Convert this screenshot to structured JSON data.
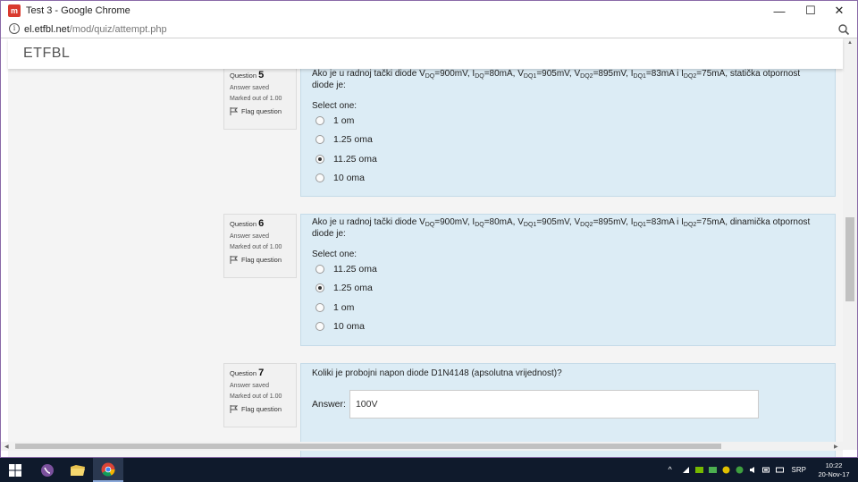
{
  "window": {
    "title": "Test 3 - Google Chrome",
    "app_icon_letter": "m",
    "minimize": "—",
    "maximize": "☐",
    "close": "✕"
  },
  "address_bar": {
    "host": "el.etfbl.net",
    "path": "/mod/quiz/attempt.php"
  },
  "site": {
    "brand": "ETFBL"
  },
  "questions": [
    {
      "label": "Question",
      "number": "5",
      "status": "Answer saved",
      "marked": "Marked out of 1.00",
      "flag": "Flag question",
      "text_parts": [
        "Ako je u radnoj tački diode V",
        "DQ",
        "=900mV, I",
        "DQ",
        "=80mA, V",
        "DQ1",
        "=905mV, V",
        "DQ2",
        "=895mV, I",
        "DQ1",
        "=83mA i I",
        "DQ2",
        "=75mA, statička otpornost diode je:"
      ],
      "select_one": "Select one:",
      "options": [
        "1 om",
        "1.25 oma",
        "11.25 oma",
        "10 oma"
      ],
      "selected_index": 2
    },
    {
      "label": "Question",
      "number": "6",
      "status": "Answer saved",
      "marked": "Marked out of 1.00",
      "flag": "Flag question",
      "text_parts": [
        "Ako je u radnoj tački diode V",
        "DQ",
        "=900mV, I",
        "DQ",
        "=80mA, V",
        "DQ1",
        "=905mV, V",
        "DQ2",
        "=895mV, I",
        "DQ1",
        "=83mA i I",
        "DQ2",
        "=75mA, dinamička otpornost diode je:"
      ],
      "select_one": "Select one:",
      "options": [
        "11.25 oma",
        "1.25 oma",
        "1 om",
        "10 oma"
      ],
      "selected_index": 1
    },
    {
      "label": "Question",
      "number": "7",
      "status": "Answer saved",
      "marked": "Marked out of 1.00",
      "flag": "Flag question",
      "text": "Koliki je probojni napon diode D1N4148 (apsolutna vrijednost)?",
      "answer_label": "Answer:",
      "answer_value": "100V"
    }
  ],
  "taskbar": {
    "language": "SRP",
    "time": "10:22",
    "date": "20-Nov-17"
  },
  "colors": {
    "question_bg": "#dcecf5",
    "taskbar_bg": "#0f1a2c",
    "window_border": "#8a6aa8"
  }
}
